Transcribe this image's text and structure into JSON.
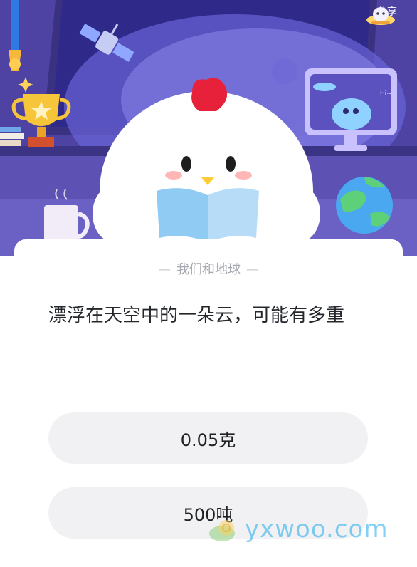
{
  "header": {
    "share_label": "分享",
    "share_icon": "ufo-icon",
    "speech_bubble_text": "Hi~"
  },
  "card": {
    "category": "我们和地球",
    "question": "漂浮在天空中的一朵云，可能有多重",
    "options": [
      {
        "label": "0.05克"
      },
      {
        "label": "500吨"
      }
    ]
  },
  "watermark": {
    "text": "yxwoo.com"
  },
  "colors": {
    "scene_purple": "#5446ad",
    "card_bg": "#ffffff",
    "option_bg": "#f1f1f4",
    "question_text": "#24272b",
    "category_text": "#a4a7ad"
  }
}
